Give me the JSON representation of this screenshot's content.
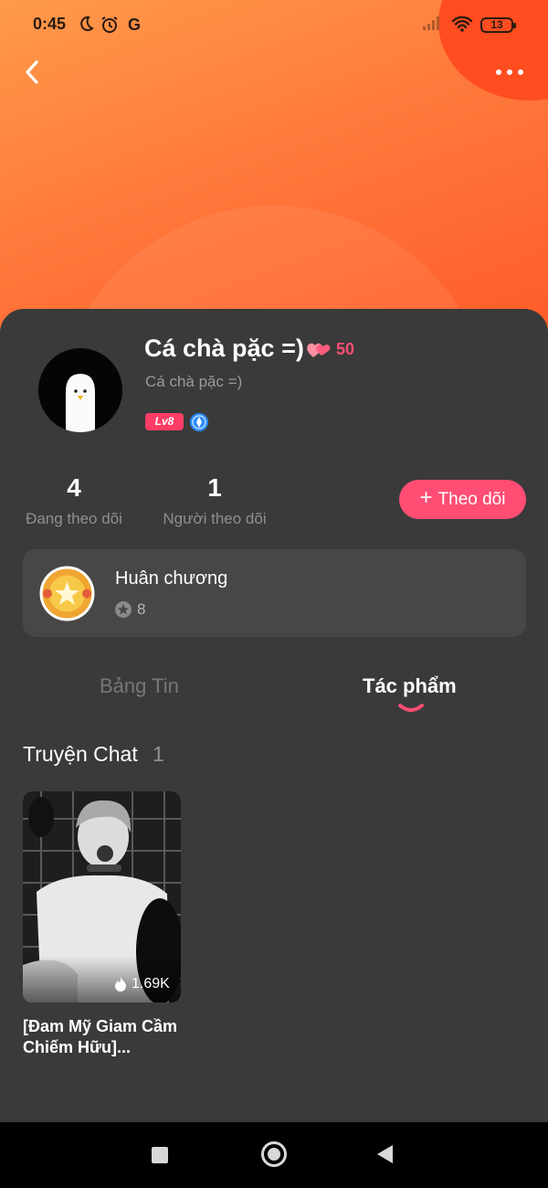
{
  "status_bar": {
    "time": "0:45",
    "icons": [
      "moon-icon",
      "alarm-icon",
      "google-icon",
      "signal-icon",
      "wifi-icon"
    ],
    "google_glyph": "G",
    "battery": "13"
  },
  "header": {
    "back_icon": "chevron-left-icon",
    "more_icon": "more-horizontal-icon"
  },
  "profile": {
    "name": "Cá chà pặc =)",
    "hearts_count": "50",
    "username": "Cá chà pặc =)",
    "level": "Lv8"
  },
  "stats": {
    "following_count": "4",
    "following_label": "Đang theo dõi",
    "followers_count": "1",
    "followers_label": "Người theo dõi"
  },
  "follow_button": {
    "plus": "+",
    "label": "Theo dõi"
  },
  "medal": {
    "title": "Huân chương",
    "count": "8"
  },
  "tabs": [
    {
      "label": "Bảng Tin",
      "active": false
    },
    {
      "label": "Tác phẩm",
      "active": true
    }
  ],
  "section": {
    "title": "Truyện Chat",
    "count": "1"
  },
  "books": [
    {
      "views": "1.69K",
      "title": "[Đam Mỹ Giam Cầm Chiếm Hữu]..."
    }
  ],
  "colors": {
    "accent": "#ff4d73",
    "header_gradient_start": "#ff9a4a",
    "header_gradient_end": "#ff5a28",
    "card_bg": "#3a3a3a"
  }
}
